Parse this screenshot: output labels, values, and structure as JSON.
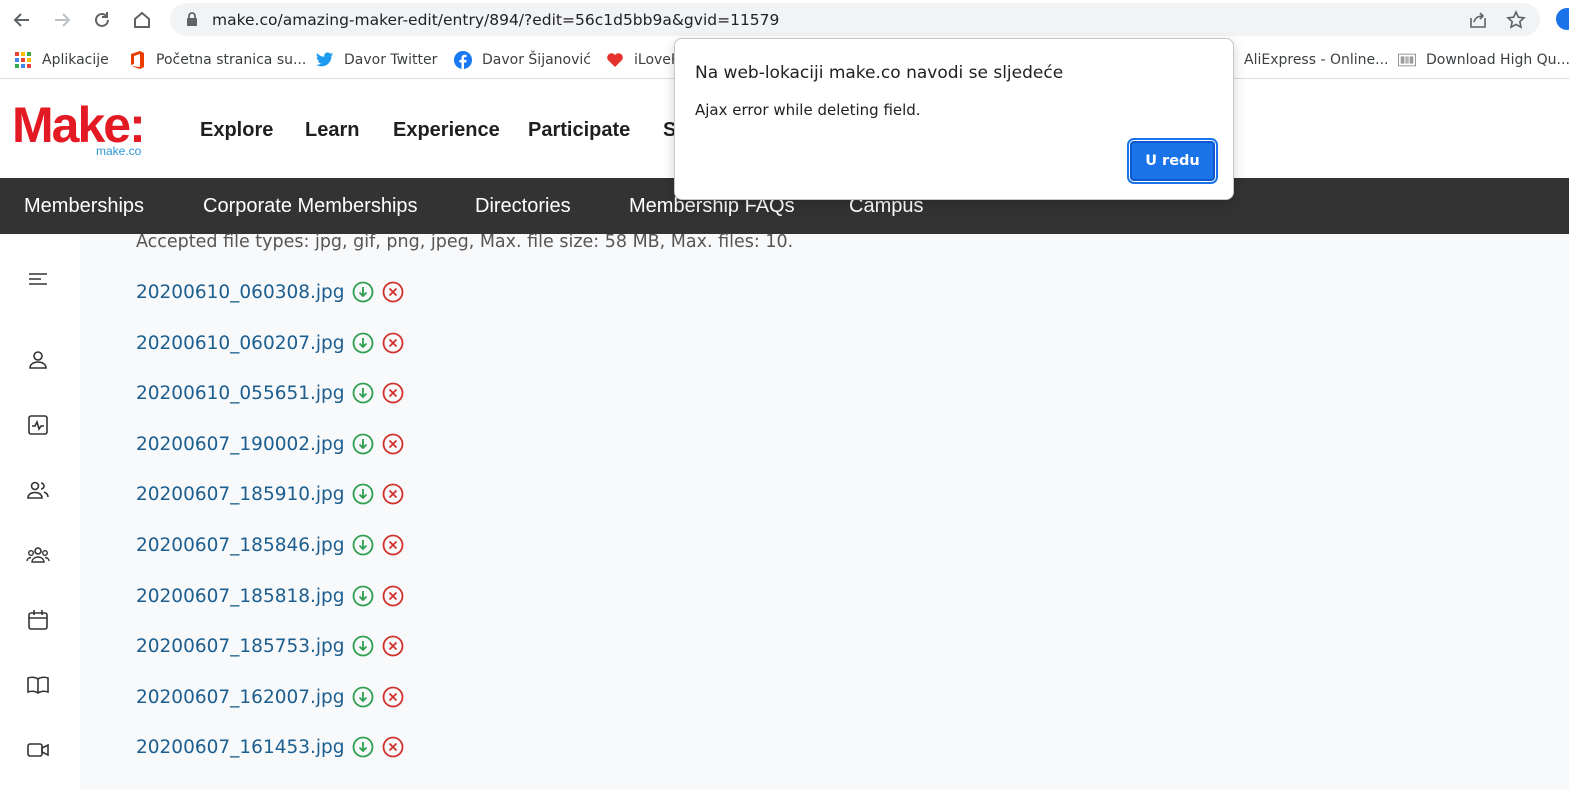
{
  "browser": {
    "url": "make.co/amazing-maker-edit/entry/894/?edit=56c1d5bb9a&gvid=11579",
    "bookmarks": [
      {
        "label": "Aplikacije",
        "icon": "apps-grid-icon"
      },
      {
        "label": "Početna stranica su...",
        "icon": "office-icon"
      },
      {
        "label": "Davor Twitter",
        "icon": "twitter-icon"
      },
      {
        "label": "Davor Šijanović",
        "icon": "facebook-icon"
      },
      {
        "label": "iLoveP",
        "icon": "ilovepdf-icon"
      },
      {
        "label": "AliExpress - Online...",
        "icon": "aliexpress-icon"
      },
      {
        "label": "Download High Qu...",
        "icon": "download-icon"
      }
    ]
  },
  "site": {
    "logo": "Make:",
    "logo_sub": "make.co",
    "main_nav": [
      "Explore",
      "Learn",
      "Experience",
      "Participate",
      "S"
    ],
    "sub_nav": [
      "Memberships",
      "Corporate Memberships",
      "Directories",
      "Membership FAQs",
      "Campus"
    ]
  },
  "side_rail": {
    "icons": [
      "menu-icon",
      "user-icon",
      "activity-icon",
      "friends-icon",
      "groups-icon",
      "calendar-icon",
      "book-icon",
      "video-icon"
    ]
  },
  "upload": {
    "accepted_text": "Accepted file types: jpg, gif, png, jpeg, Max. file size: 58 MB, Max. files: 10.",
    "files": [
      "20200610_060308.jpg",
      "20200610_060207.jpg",
      "20200610_055651.jpg",
      "20200607_190002.jpg",
      "20200607_185910.jpg",
      "20200607_185846.jpg",
      "20200607_185818.jpg",
      "20200607_185753.jpg",
      "20200607_162007.jpg",
      "20200607_161453.jpg"
    ]
  },
  "dialog": {
    "title": "Na web-lokaciji make.co navodi se sljedeće",
    "message": "Ajax error while deleting field.",
    "ok_label": "U redu"
  },
  "colors": {
    "brand_red": "#e31a23",
    "link_blue": "#1b5e8f",
    "download_green": "#2e9e4f",
    "delete_red": "#d0312d",
    "subnav_bg": "#333333",
    "button_blue": "#1a73e8"
  }
}
